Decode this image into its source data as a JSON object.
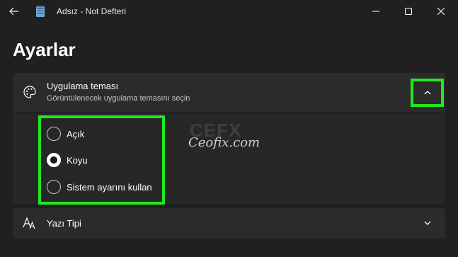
{
  "window": {
    "title": "Adsız - Not Defteri",
    "back_icon": "arrow-left-icon",
    "app_icon": "notepad-icon",
    "controls": [
      "minimize-icon",
      "maximize-icon",
      "close-icon"
    ]
  },
  "page": {
    "title": "Ayarlar"
  },
  "theme_setting": {
    "icon": "palette-icon",
    "title": "Uygulama teması",
    "description": "Görüntülenecek uygulama temasını seçin",
    "expanded": true,
    "options": [
      {
        "label": "Açık",
        "checked": false
      },
      {
        "label": "Koyu",
        "checked": true
      },
      {
        "label": "Sistem ayarını kullan",
        "checked": false
      }
    ]
  },
  "watermark": {
    "logo": "CEFX",
    "text": "Ceofix.com"
  },
  "font_setting": {
    "icon": "font-icon",
    "title": "Yazı Tipi"
  },
  "colors": {
    "background": "#202020",
    "card": "#2b2b2b",
    "highlight": "#22e81e"
  }
}
